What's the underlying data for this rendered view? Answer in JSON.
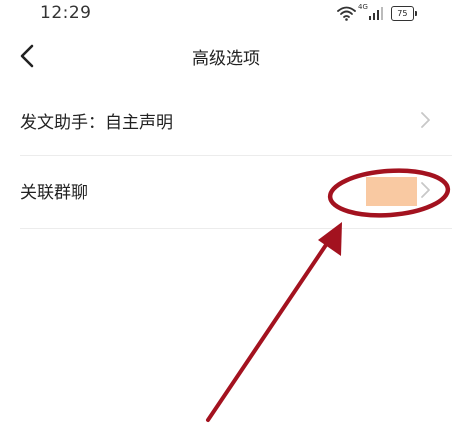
{
  "status_bar": {
    "time": "12:29",
    "network_label": "4G",
    "battery_level": "75",
    "icons": [
      "wifi-icon",
      "signal-icon",
      "battery-icon"
    ]
  },
  "header": {
    "back_icon": "chevron-left-icon",
    "title": "高级选项"
  },
  "list": {
    "items": [
      {
        "label": "发文助手：自主声明",
        "icon": "chevron-right-icon"
      },
      {
        "label": "关联群聊",
        "icon": "chevron-right-icon",
        "value_redacted": true
      }
    ]
  },
  "annotation": {
    "shapes": [
      "red-ellipse",
      "red-arrow"
    ],
    "color": "#a3121f"
  },
  "colors": {
    "background": "#ffffff",
    "text": "#222222",
    "chevron": "#c8c8c8",
    "divider": "#ececec",
    "redaction": "#f9c9a2",
    "annotation_red": "#a3121f"
  }
}
